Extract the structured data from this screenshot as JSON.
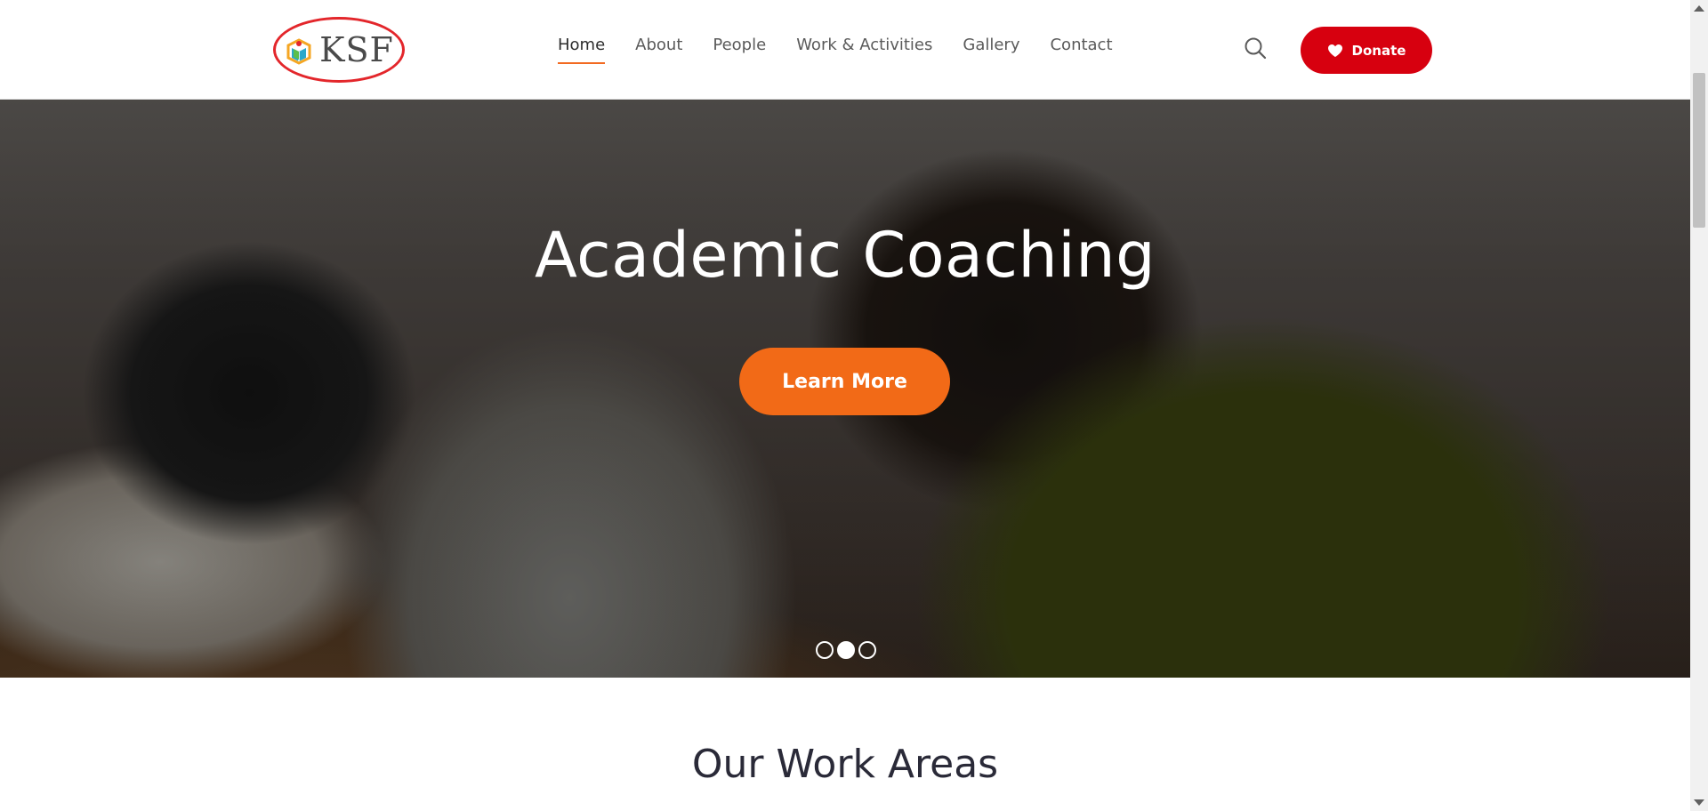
{
  "header": {
    "logo_text": "KSF",
    "nav": [
      {
        "label": "Home",
        "active": true
      },
      {
        "label": "About",
        "active": false
      },
      {
        "label": "People",
        "active": false
      },
      {
        "label": "Work & Activities",
        "active": false
      },
      {
        "label": "Gallery",
        "active": false
      },
      {
        "label": "Contact",
        "active": false
      }
    ],
    "search_icon": "search-icon",
    "donate_label": "Donate",
    "donate_icon": "heart-icon"
  },
  "hero": {
    "title": "Academic Coaching",
    "cta_label": "Learn More",
    "slides_total": 3,
    "active_slide": 2
  },
  "section": {
    "title": "Our Work Areas"
  },
  "colors": {
    "accent": "#f26a17",
    "donate": "#d7000f",
    "logo_ring": "#e3262b",
    "nav_underline": "#f26a21"
  }
}
